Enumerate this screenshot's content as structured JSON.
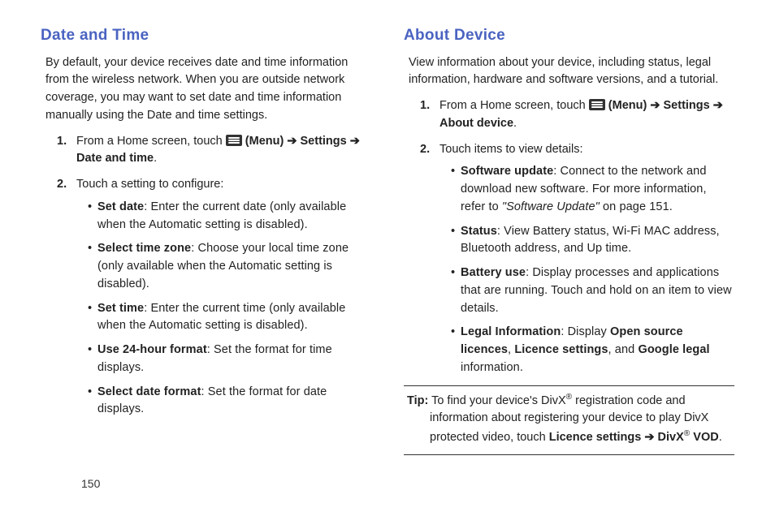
{
  "pageNumber": "150",
  "left": {
    "heading": "Date and Time",
    "intro": "By default, your device receives date and time information from the wireless network. When you are outside network coverage, you may want to set date and time information manually using the Date and time settings.",
    "step1_a": "From a Home screen, touch ",
    "step1_b": " (Menu) ",
    "step1_c": " Settings ",
    "step1_d": " Date and time",
    "step1_e": ".",
    "step2": "Touch a setting to configure:",
    "items": [
      {
        "name": "Set date",
        "desc": ": Enter the current date (only available when the Automatic setting is disabled)."
      },
      {
        "name": "Select time zone",
        "desc": ": Choose your local time zone (only available when the Automatic setting is disabled)."
      },
      {
        "name": "Set time",
        "desc": ": Enter the current time (only available when the Automatic setting is disabled)."
      },
      {
        "name": "Use 24-hour format",
        "desc": ": Set the format for time displays."
      },
      {
        "name": "Select date format",
        "desc": ": Set the format for date displays."
      }
    ]
  },
  "right": {
    "heading": "About Device",
    "intro": "View information about your device, including status, legal information, hardware and software versions, and a tutorial.",
    "step1_a": "From a Home screen, touch ",
    "step1_b": " (Menu) ",
    "step1_c": " Settings ",
    "step1_d": " About device",
    "step1_e": ".",
    "step2": "Touch items to view details:",
    "items": {
      "su": {
        "name": "Software update",
        "a": ": Connect to the network and download new software. For more information, refer to ",
        "ref": "\"Software Update\"",
        "b": " on page 151."
      },
      "st": {
        "name": "Status",
        "desc": ": View Battery status, Wi-Fi MAC address, Bluetooth address, and Up time."
      },
      "bu": {
        "name": "Battery use",
        "desc": ": Display processes and applications that are running. Touch and hold on an item to view details."
      },
      "li": {
        "name": "Legal Information",
        "a": ": Display ",
        "osl": "Open source licences",
        "b": ", ",
        "ls": "Licence settings",
        "c": ", and ",
        "gl": "Google legal",
        "d": " information."
      }
    },
    "tip": {
      "label": "Tip:",
      "a": " To find your device's DivX",
      "b": " registration code and information about registering your device to play DivX protected video, touch ",
      "ls": "Licence settings ",
      "dx": " DivX",
      "vod": " VOD",
      "end": "."
    }
  },
  "glyphs": {
    "arrow": "➔",
    "reg": "®"
  }
}
